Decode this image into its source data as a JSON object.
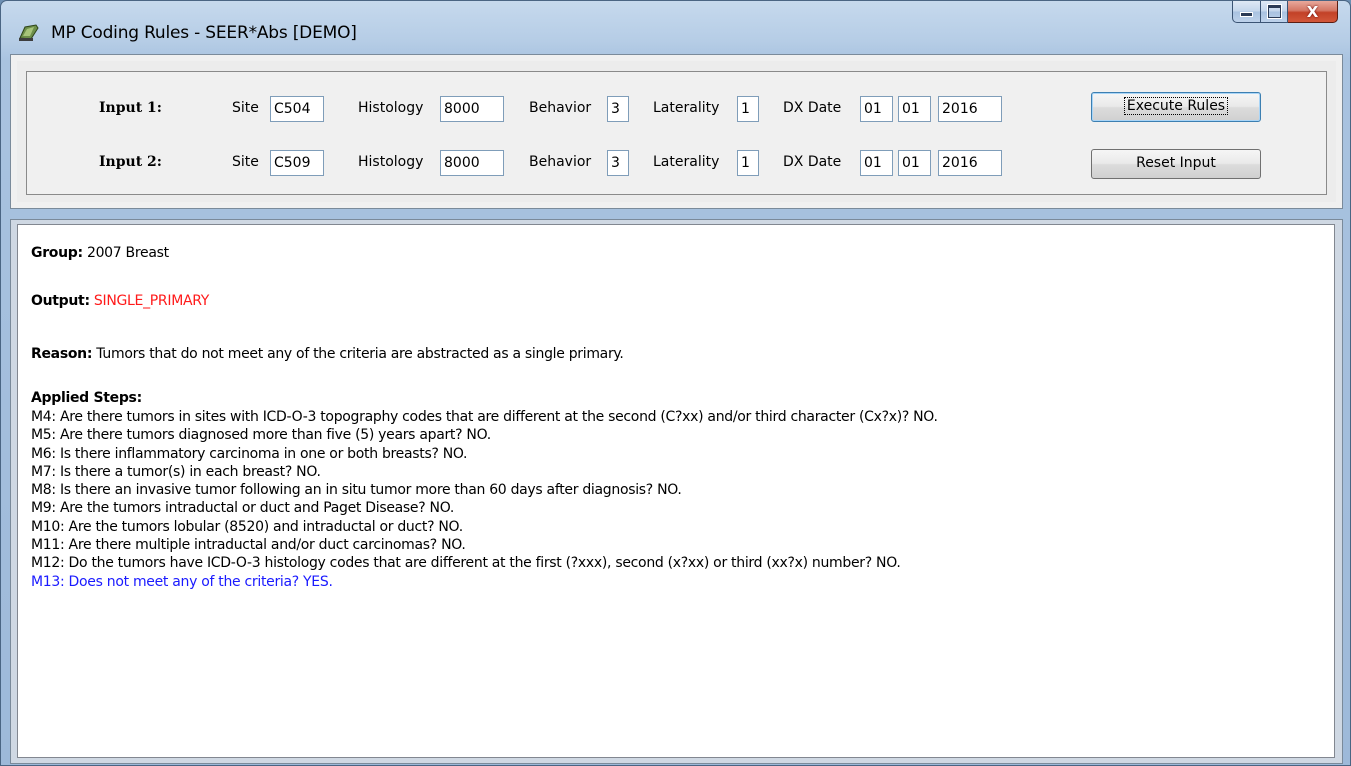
{
  "window": {
    "title": "MP Coding Rules - SEER*Abs [DEMO]",
    "close_glyph": "X"
  },
  "inputs": [
    {
      "label": "Input 1:",
      "site_label": "Site",
      "site": "C504",
      "histology_label": "Histology",
      "histology": "8000",
      "behavior_label": "Behavior",
      "behavior": "3",
      "laterality_label": "Laterality",
      "laterality": "1",
      "dxdate_label": "DX Date",
      "dx_month": "01",
      "dx_day": "01",
      "dx_year": "2016"
    },
    {
      "label": "Input 2:",
      "site_label": "Site",
      "site": "C509",
      "histology_label": "Histology",
      "histology": "8000",
      "behavior_label": "Behavior",
      "behavior": "3",
      "laterality_label": "Laterality",
      "laterality": "1",
      "dxdate_label": "DX Date",
      "dx_month": "01",
      "dx_day": "01",
      "dx_year": "2016"
    }
  ],
  "buttons": {
    "execute": "Execute Rules",
    "reset": "Reset Input"
  },
  "result": {
    "group_label": "Group:",
    "group": "2007 Breast",
    "output_label": "Output:",
    "output": "SINGLE_PRIMARY",
    "reason_label": "Reason:",
    "reason": "Tumors that do not meet any of the criteria are abstracted as a single primary.",
    "steps_label": "Applied Steps:",
    "steps": [
      "M4: Are there tumors in sites with ICD-O-3 topography codes that are different at the second (C?xx) and/or third character (Cx?x)? NO.",
      "M5: Are there tumors diagnosed more than five (5) years apart? NO.",
      "M6: Is there inflammatory carcinoma in one or both breasts? NO.",
      "M7: Is there a tumor(s) in each breast? NO.",
      "M8: Is there an invasive tumor following an in situ tumor more than 60 days after diagnosis? NO.",
      "M9: Are the tumors intraductal or duct and Paget Disease? NO.",
      "M10: Are the tumors lobular (8520) and intraductal or duct? NO.",
      "M11: Are there multiple intraductal and/or duct carcinomas? NO.",
      "M12: Do the tumors have ICD-O-3 histology codes that are different at the first (?xxx), second (x?xx) or third (xx?x) number? NO.",
      "M13: Does not meet any of the criteria? YES."
    ]
  },
  "colors": {
    "output_red": "#ff1a1a",
    "final_step_blue": "#1a1aff",
    "titlebar": "#b6cde6"
  },
  "icons": [
    "app-icon",
    "minimize-icon",
    "maximize-icon",
    "close-icon"
  ]
}
